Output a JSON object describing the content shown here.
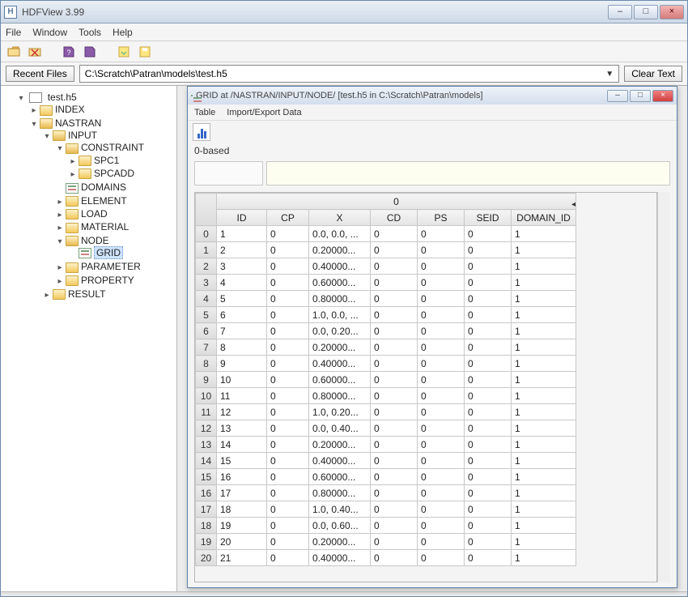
{
  "titlebar": {
    "title": "HDFView 3.99"
  },
  "window_controls": {
    "minimize": "–",
    "maximize": "□",
    "close": "×"
  },
  "menubar": {
    "file": "File",
    "window": "Window",
    "tools": "Tools",
    "help": "Help"
  },
  "pathbar": {
    "recent_button": "Recent Files",
    "path": "C:\\Scratch\\Patran\\models\\test.h5",
    "clear_button": "Clear Text"
  },
  "tree": {
    "root": "test.h5",
    "nodes": {
      "index": "INDEX",
      "nastran": "NASTRAN",
      "input": "INPUT",
      "constraint": "CONSTRAINT",
      "spc1": "SPC1",
      "spcadd": "SPCADD",
      "domains": "DOMAINS",
      "element": "ELEMENT",
      "load": "LOAD",
      "material": "MATERIAL",
      "node": "NODE",
      "grid": "GRID",
      "parameter": "PARAMETER",
      "property": "PROPERTY",
      "result": "RESULT"
    }
  },
  "inner_window": {
    "title": "GRID  at  /NASTRAN/INPUT/NODE/  [test.h5  in  C:\\Scratch\\Patran\\models]",
    "menubar": {
      "table": "Table",
      "import_export": "Import/Export Data"
    },
    "zero_based": "0-based",
    "group_header": "0",
    "columns": {
      "id": "ID",
      "cp": "CP",
      "x": "X",
      "cd": "CD",
      "ps": "PS",
      "seid": "SEID",
      "domain": "DOMAIN_ID"
    },
    "rows": [
      {
        "idx": "0",
        "id": "1",
        "cp": "0",
        "x": "0.0, 0.0, ...",
        "cd": "0",
        "ps": "0",
        "seid": "0",
        "domain": "1"
      },
      {
        "idx": "1",
        "id": "2",
        "cp": "0",
        "x": "0.20000...",
        "cd": "0",
        "ps": "0",
        "seid": "0",
        "domain": "1"
      },
      {
        "idx": "2",
        "id": "3",
        "cp": "0",
        "x": "0.40000...",
        "cd": "0",
        "ps": "0",
        "seid": "0",
        "domain": "1"
      },
      {
        "idx": "3",
        "id": "4",
        "cp": "0",
        "x": "0.60000...",
        "cd": "0",
        "ps": "0",
        "seid": "0",
        "domain": "1"
      },
      {
        "idx": "4",
        "id": "5",
        "cp": "0",
        "x": "0.80000...",
        "cd": "0",
        "ps": "0",
        "seid": "0",
        "domain": "1"
      },
      {
        "idx": "5",
        "id": "6",
        "cp": "0",
        "x": "1.0, 0.0, ...",
        "cd": "0",
        "ps": "0",
        "seid": "0",
        "domain": "1"
      },
      {
        "idx": "6",
        "id": "7",
        "cp": "0",
        "x": "0.0, 0.20...",
        "cd": "0",
        "ps": "0",
        "seid": "0",
        "domain": "1"
      },
      {
        "idx": "7",
        "id": "8",
        "cp": "0",
        "x": "0.20000...",
        "cd": "0",
        "ps": "0",
        "seid": "0",
        "domain": "1"
      },
      {
        "idx": "8",
        "id": "9",
        "cp": "0",
        "x": "0.40000...",
        "cd": "0",
        "ps": "0",
        "seid": "0",
        "domain": "1"
      },
      {
        "idx": "9",
        "id": "10",
        "cp": "0",
        "x": "0.60000...",
        "cd": "0",
        "ps": "0",
        "seid": "0",
        "domain": "1"
      },
      {
        "idx": "10",
        "id": "11",
        "cp": "0",
        "x": "0.80000...",
        "cd": "0",
        "ps": "0",
        "seid": "0",
        "domain": "1"
      },
      {
        "idx": "11",
        "id": "12",
        "cp": "0",
        "x": "1.0, 0.20...",
        "cd": "0",
        "ps": "0",
        "seid": "0",
        "domain": "1"
      },
      {
        "idx": "12",
        "id": "13",
        "cp": "0",
        "x": "0.0, 0.40...",
        "cd": "0",
        "ps": "0",
        "seid": "0",
        "domain": "1"
      },
      {
        "idx": "13",
        "id": "14",
        "cp": "0",
        "x": "0.20000...",
        "cd": "0",
        "ps": "0",
        "seid": "0",
        "domain": "1"
      },
      {
        "idx": "14",
        "id": "15",
        "cp": "0",
        "x": "0.40000...",
        "cd": "0",
        "ps": "0",
        "seid": "0",
        "domain": "1"
      },
      {
        "idx": "15",
        "id": "16",
        "cp": "0",
        "x": "0.60000...",
        "cd": "0",
        "ps": "0",
        "seid": "0",
        "domain": "1"
      },
      {
        "idx": "16",
        "id": "17",
        "cp": "0",
        "x": "0.80000...",
        "cd": "0",
        "ps": "0",
        "seid": "0",
        "domain": "1"
      },
      {
        "idx": "17",
        "id": "18",
        "cp": "0",
        "x": "1.0, 0.40...",
        "cd": "0",
        "ps": "0",
        "seid": "0",
        "domain": "1"
      },
      {
        "idx": "18",
        "id": "19",
        "cp": "0",
        "x": "0.0, 0.60...",
        "cd": "0",
        "ps": "0",
        "seid": "0",
        "domain": "1"
      },
      {
        "idx": "19",
        "id": "20",
        "cp": "0",
        "x": "0.20000...",
        "cd": "0",
        "ps": "0",
        "seid": "0",
        "domain": "1"
      },
      {
        "idx": "20",
        "id": "21",
        "cp": "0",
        "x": "0.40000...",
        "cd": "0",
        "ps": "0",
        "seid": "0",
        "domain": "1"
      }
    ]
  }
}
